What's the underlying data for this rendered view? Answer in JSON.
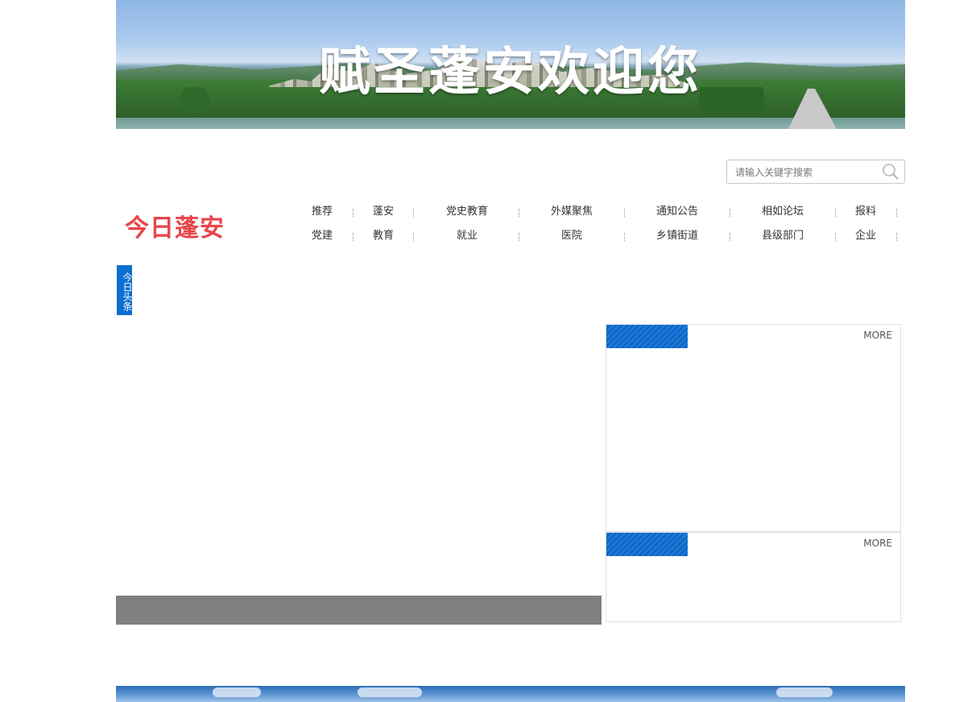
{
  "banner": {
    "title": "赋圣蓬安欢迎您"
  },
  "search": {
    "placeholder": "请输入关键字搜索"
  },
  "logo": {
    "text": "今日蓬安"
  },
  "nav": {
    "row1": [
      "推荐",
      "蓬安",
      "党史教育",
      "外媒聚焦",
      "通知公告",
      "相如论坛",
      "报料"
    ],
    "row2": [
      "党建",
      "教育",
      "就业",
      "医院",
      "乡镇街道",
      "县级部门",
      "企业"
    ]
  },
  "headline_tag": "今日头条",
  "panels": [
    {
      "more_label": "MORE"
    },
    {
      "more_label": "MORE"
    }
  ],
  "colors": {
    "accent_blue": "#0d6fd0",
    "logo_red": "#e8454a",
    "slider_bar": "#808080"
  }
}
